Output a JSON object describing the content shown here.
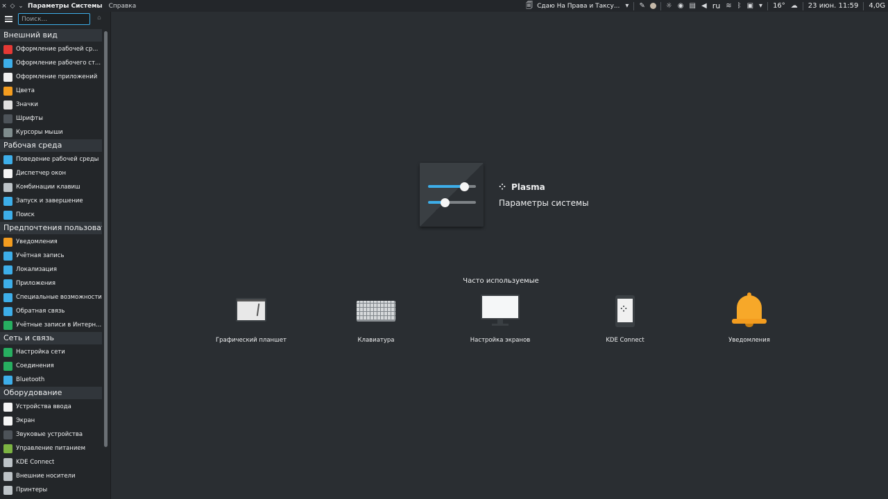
{
  "topbar": {
    "close_glyph": "×",
    "pin_glyph": "◇",
    "menu_glyph": "⌄",
    "app_title": "Параметры Системы",
    "help_menu": "Справка",
    "media_title": "Сдаю На Права и Таксу...",
    "language": "ru",
    "temperature": "16°",
    "clock": "23 июн. 11:59",
    "memory": "4,0G"
  },
  "sidebar": {
    "search_placeholder": "Поиск...",
    "categories": [
      {
        "title": "Внешний вид",
        "items": [
          {
            "label": "Оформление рабочей ср...",
            "icon": "paint-icon",
            "color": "#e53935"
          },
          {
            "label": "Оформление рабочего ст...",
            "icon": "desktop-theme-icon",
            "color": "#3daee9"
          },
          {
            "label": "Оформление приложений",
            "icon": "brush-icon",
            "color": "#f0f0f0"
          },
          {
            "label": "Цвета",
            "icon": "colors-icon",
            "color": "#f39c1f"
          },
          {
            "label": "Значки",
            "icon": "icons-icon",
            "color": "#e0e0e0"
          },
          {
            "label": "Шрифты",
            "icon": "fonts-icon",
            "color": "#4d5359"
          },
          {
            "label": "Курсоры мыши",
            "icon": "cursor-icon",
            "color": "#7f8c8d"
          }
        ]
      },
      {
        "title": "Рабочая среда",
        "items": [
          {
            "label": "Поведение рабочей среды",
            "icon": "workspace-icon",
            "color": "#3daee9"
          },
          {
            "label": "Диспетчер окон",
            "icon": "window-icon",
            "color": "#f5f5f5"
          },
          {
            "label": "Комбинации клавиш",
            "icon": "keyboard-icon",
            "color": "#bdc3c7"
          },
          {
            "label": "Запуск и завершение",
            "icon": "startup-icon",
            "color": "#3daee9"
          },
          {
            "label": "Поиск",
            "icon": "search-icon",
            "color": "#3daee9"
          }
        ]
      },
      {
        "title": "Предпочтения пользователя",
        "items": [
          {
            "label": "Уведомления",
            "icon": "bell-icon",
            "color": "#f39c1f"
          },
          {
            "label": "Учётная запись",
            "icon": "user-icon",
            "color": "#3daee9"
          },
          {
            "label": "Локализация",
            "icon": "locale-icon",
            "color": "#3daee9"
          },
          {
            "label": "Приложения",
            "icon": "apps-icon",
            "color": "#3daee9"
          },
          {
            "label": "Специальные возможности",
            "icon": "accessibility-icon",
            "color": "#3daee9"
          },
          {
            "label": "Обратная связь",
            "icon": "feedback-icon",
            "color": "#3daee9"
          },
          {
            "label": "Учётные записи в Интерн...",
            "icon": "online-accounts-icon",
            "color": "#27ae60"
          }
        ]
      },
      {
        "title": "Сеть и связь",
        "items": [
          {
            "label": "Настройка сети",
            "icon": "network-icon",
            "color": "#27ae60"
          },
          {
            "label": "Соединения",
            "icon": "connections-icon",
            "color": "#27ae60"
          },
          {
            "label": "Bluetooth",
            "icon": "bluetooth-icon",
            "color": "#3daee9"
          }
        ]
      },
      {
        "title": "Оборудование",
        "items": [
          {
            "label": "Устройства ввода",
            "icon": "input-devices-icon",
            "color": "#f5f5f5"
          },
          {
            "label": "Экран",
            "icon": "display-icon",
            "color": "#f5f5f5"
          },
          {
            "label": "Звуковые устройства",
            "icon": "audio-icon",
            "color": "#4d5359"
          },
          {
            "label": "Управление питанием",
            "icon": "power-icon",
            "color": "#7cb342"
          },
          {
            "label": "KDE Connect",
            "icon": "phone-icon",
            "color": "#bdc3c7"
          },
          {
            "label": "Внешние носители",
            "icon": "usb-icon",
            "color": "#bdc3c7"
          },
          {
            "label": "Принтеры",
            "icon": "printer-icon",
            "color": "#bdc3c7"
          }
        ]
      }
    ]
  },
  "main": {
    "brand": "Plasma",
    "subtitle": "Параметры системы",
    "frequent_title": "Часто используемые",
    "frequent": [
      {
        "label": "Графический планшет",
        "icon": "tablet-icon"
      },
      {
        "label": "Клавиатура",
        "icon": "keyboard-icon"
      },
      {
        "label": "Настройка экранов",
        "icon": "monitor-icon"
      },
      {
        "label": "KDE Connect",
        "icon": "kdeconnect-icon"
      },
      {
        "label": "Уведомления",
        "icon": "bell-icon"
      }
    ]
  },
  "colors": {
    "accent": "#3daee9",
    "panel": "#23262a",
    "background": "#2a2e32",
    "bell": "#f39c1f"
  }
}
